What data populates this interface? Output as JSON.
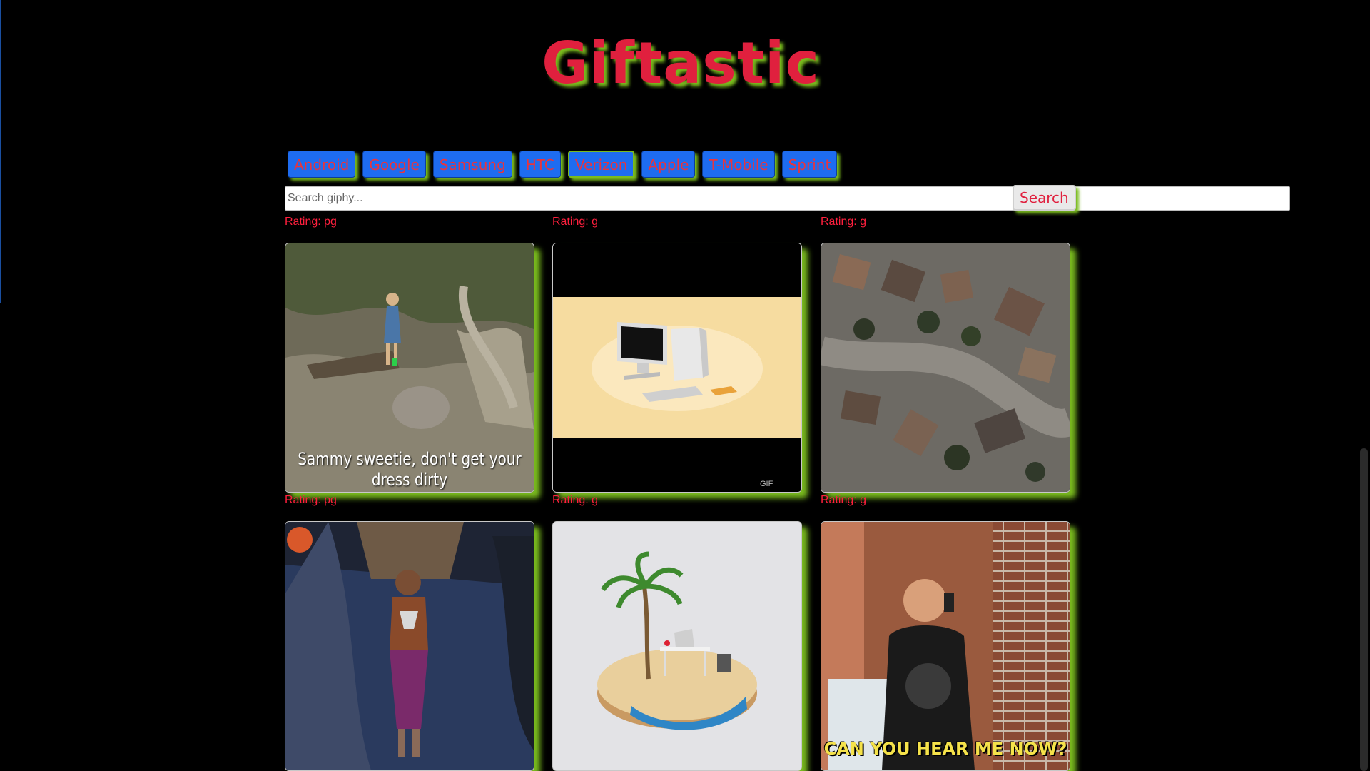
{
  "app": {
    "title": "Giftastic"
  },
  "topics": [
    {
      "label": "Android",
      "active": false
    },
    {
      "label": "Google",
      "active": false
    },
    {
      "label": "Samsung",
      "active": false
    },
    {
      "label": "HTC",
      "active": false
    },
    {
      "label": "Verizon",
      "active": true
    },
    {
      "label": "Apple",
      "active": false
    },
    {
      "label": "T-Mobile",
      "active": false
    },
    {
      "label": "Sprint",
      "active": false
    }
  ],
  "search": {
    "placeholder": "Search giphy...",
    "value": "",
    "button_label": "Search"
  },
  "gifs": [
    {
      "rating": "Rating: pg",
      "caption": "Sammy sweetie, don't get your dress dirty",
      "subject": "girl-walking-rocky-slope"
    },
    {
      "rating": "Rating: g",
      "caption": "",
      "subject": "desktop-computer-illustration"
    },
    {
      "rating": "Rating: g",
      "caption": "",
      "subject": "aerial-neighborhood-rooftops"
    },
    {
      "rating": "Rating: pg",
      "caption": "",
      "subject": "child-in-costume"
    },
    {
      "rating": "Rating: g",
      "caption": "",
      "subject": "island-desk-palm-tree"
    },
    {
      "rating": "Rating: g",
      "caption": "CAN YOU HEAR ME NOW?",
      "subject": "man-on-phone-storefront"
    }
  ],
  "colors": {
    "background": "#000000",
    "title": "#e0203e",
    "shadow": "#7abb1e",
    "button": "#1e6cf0",
    "rating": "#ff1f3d"
  }
}
